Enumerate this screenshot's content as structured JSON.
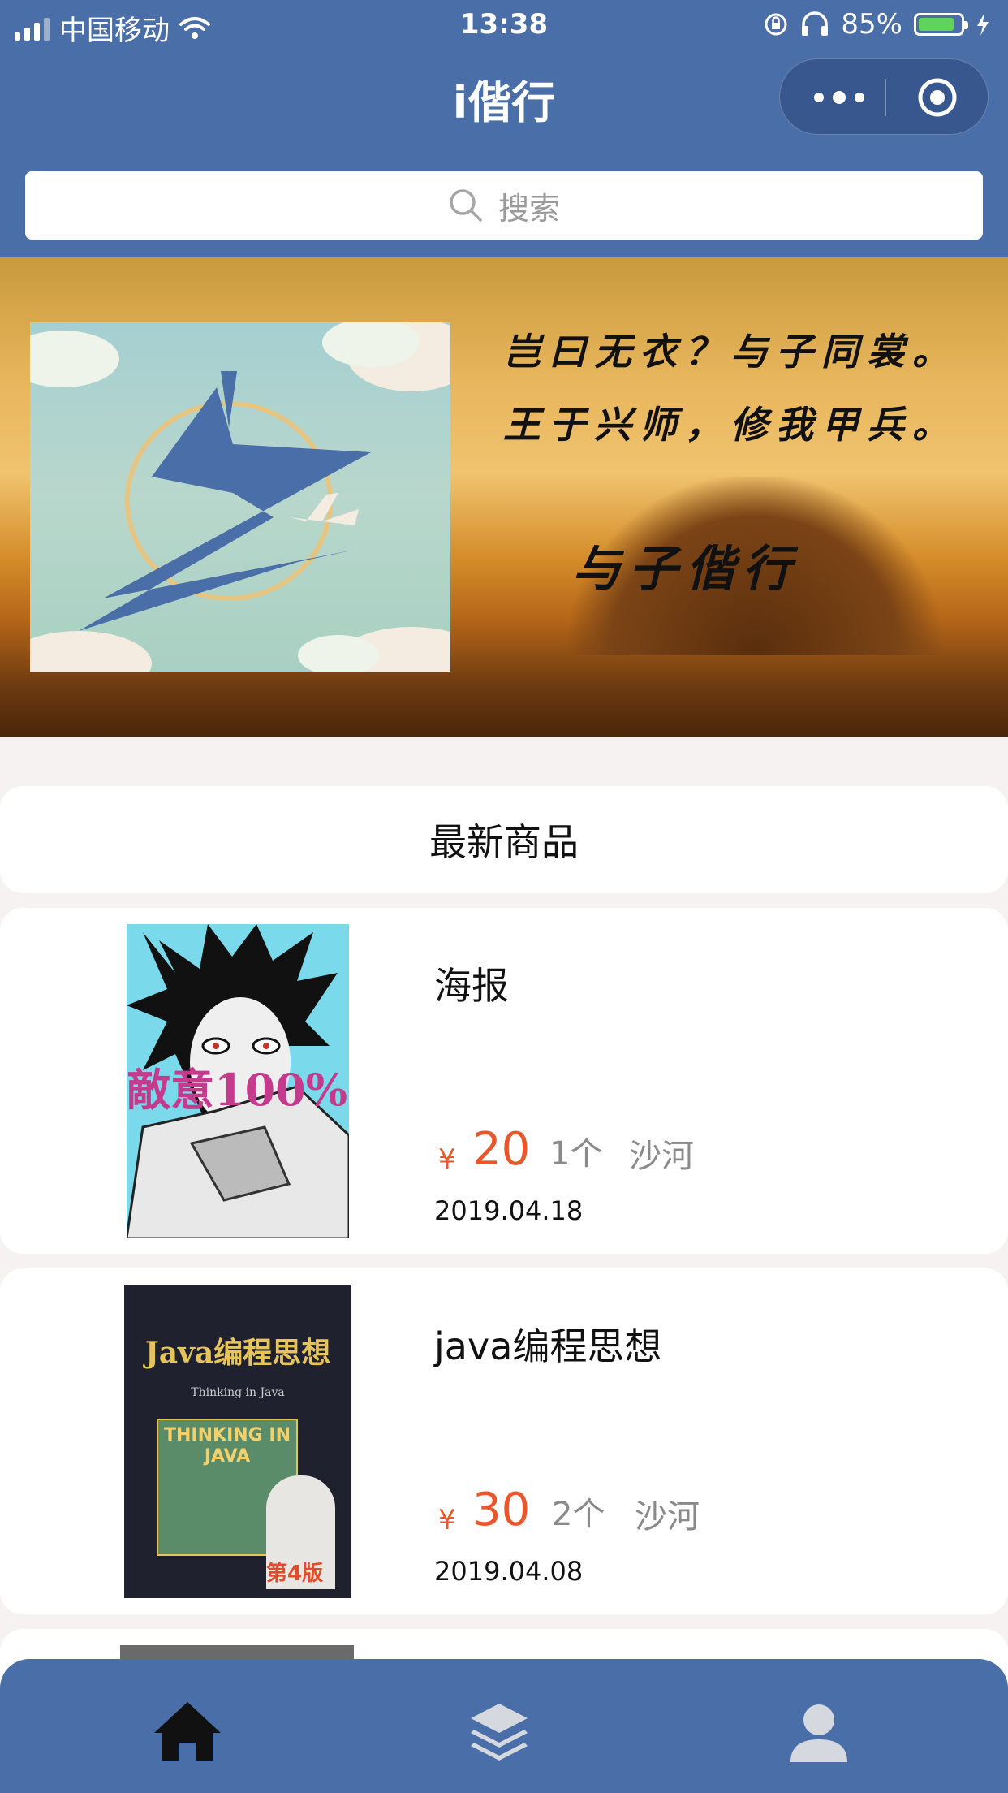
{
  "status": {
    "carrier": "中国移动",
    "time": "13:38",
    "battery": "85%",
    "battery_level": 0.85
  },
  "nav": {
    "title": "i偕行"
  },
  "search": {
    "placeholder": "搜索"
  },
  "banner": {
    "lines": [
      "岂曰无衣？与子同裳。",
      "王于兴师，修我甲兵。",
      "与子偕行"
    ]
  },
  "section": {
    "title": "最新商品"
  },
  "products": [
    {
      "title": "海报",
      "currency": "¥",
      "price": "20",
      "qty": "1个",
      "location": "沙河",
      "date": "2019.04.18",
      "cover_text": "敵意100%"
    },
    {
      "title": "java编程思想",
      "currency": "¥",
      "price": "30",
      "qty": "2个",
      "location": "沙河",
      "date": "2019.04.08",
      "cover_title": "Java编程思想",
      "cover_sub": "Thinking in Java",
      "cover_main": "THINKING IN JAVA",
      "cover_ed": "第4版"
    }
  ],
  "tabs": [
    {
      "name": "home-icon",
      "active": true
    },
    {
      "name": "layers-icon",
      "active": false
    },
    {
      "name": "user-icon",
      "active": false
    }
  ],
  "colors": {
    "header": "#4a6ea8",
    "price": "#e8572c",
    "background": "#f5f2f1"
  }
}
